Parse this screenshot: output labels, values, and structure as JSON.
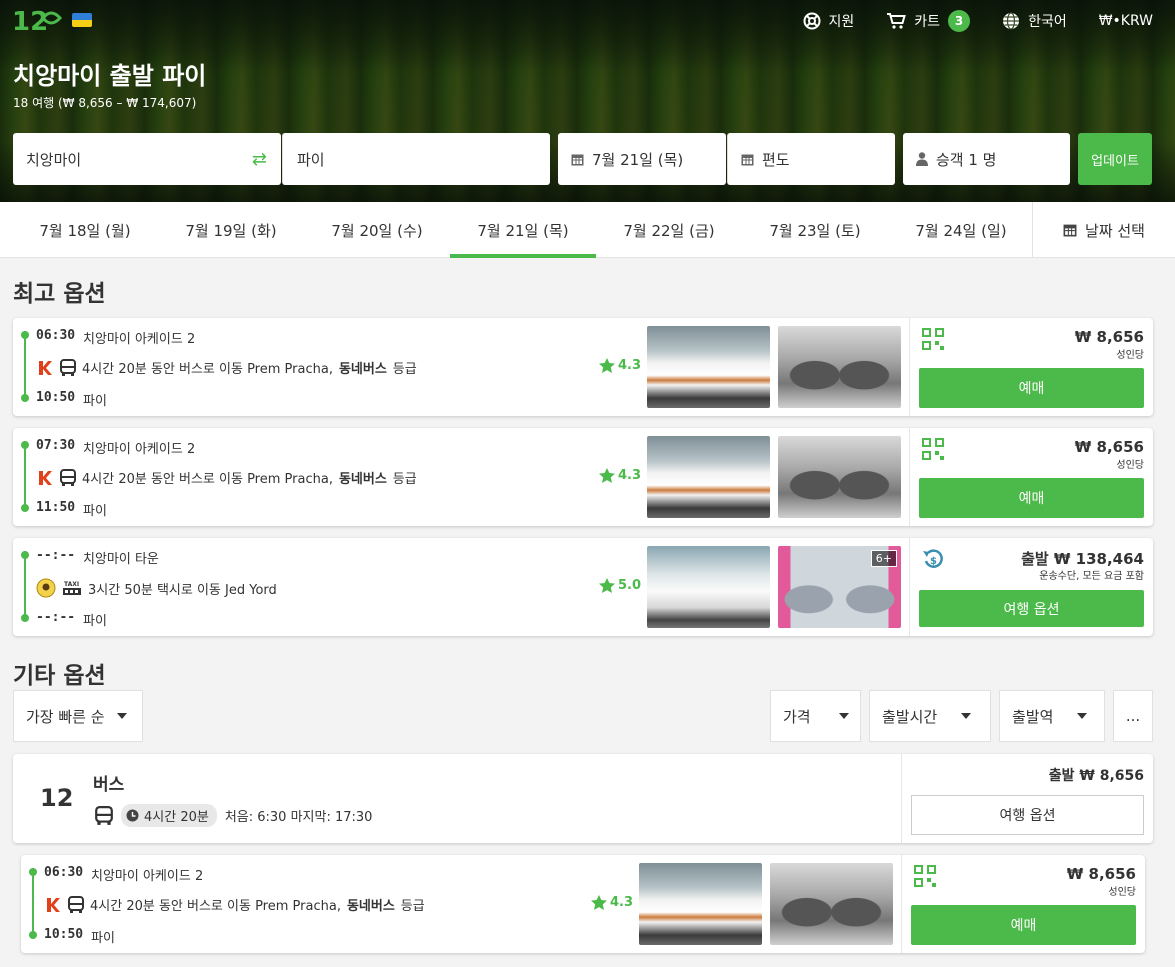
{
  "header": {
    "support": "지원",
    "cart": "카트",
    "cart_count": "3",
    "language": "한국어",
    "currency": "₩•KRW"
  },
  "hero": {
    "title": "치앙마이 출발 파이",
    "subtitle": "18 여행 (₩ 8,656 – ₩ 174,607)"
  },
  "search": {
    "from": "치앙마이",
    "to": "파이",
    "date": "7월 21일 (목)",
    "trip_type": "편도",
    "passengers": "승객 1 명",
    "update": "업데이트"
  },
  "date_tabs": [
    "7월 18일 (월)",
    "7월 19일 (화)",
    "7월 20일 (수)",
    "7월 21일 (목)",
    "7월 22일 (금)",
    "7월 23일 (토)",
    "7월 24일 (일)"
  ],
  "date_picker": "날짜 선택",
  "best": {
    "title": "최고 옵션",
    "trips": [
      {
        "dep_time": "06:30",
        "dep_place": "치앙마이 아케이드 2",
        "desc_pre": "4시간 20분 동안 버스로 이동 Prem Pracha,",
        "desc_bold": "동네버스",
        "desc_post": "등급",
        "rating": "4.3",
        "arr_time": "10:50",
        "arr_place": "파이",
        "price": "₩ 8,656",
        "price_sub": "성인당",
        "button": "예매"
      },
      {
        "dep_time": "07:30",
        "dep_place": "치앙마이 아케이드 2",
        "desc_pre": "4시간 20분 동안 버스로 이동 Prem Pracha,",
        "desc_bold": "동네버스",
        "desc_post": "등급",
        "rating": "4.3",
        "arr_time": "11:50",
        "arr_place": "파이",
        "price": "₩ 8,656",
        "price_sub": "성인당",
        "button": "예매"
      },
      {
        "dep_time": "--:--",
        "dep_place": "치앙마이 타운",
        "desc_pre": "3시간 50분 택시로 이동 Jed Yord",
        "desc_bold": "",
        "desc_post": "",
        "rating": "5.0",
        "arr_time": "--:--",
        "arr_place": "파이",
        "price": "출발 ₩ 138,464",
        "price_sub": "운송수단, 모든 요금 포함",
        "button": "여행 옵션",
        "photo_badge": "6+"
      }
    ]
  },
  "other": {
    "title": "기타 옵션",
    "sort": "가장 빠른 순",
    "filters": [
      "가격",
      "출발시간",
      "출발역"
    ],
    "more": "...",
    "operator": {
      "count": "12",
      "name": "버스",
      "duration": "4시간 20분",
      "schedule": "처음: 6:30 마지막: 17:30",
      "price": "출발 ₩ 8,656",
      "button": "여행 옵션"
    },
    "trip": {
      "dep_time": "06:30",
      "dep_place": "치앙마이 아케이드 2",
      "desc_pre": "4시간 20분 동안 버스로 이동 Prem Pracha,",
      "desc_bold": "동네버스",
      "desc_post": "등급",
      "rating": "4.3",
      "arr_time": "10:50",
      "arr_place": "파이",
      "price": "₩ 8,656",
      "price_sub": "성인당",
      "button": "예매"
    }
  },
  "colors": {
    "accent": "#4cba4a",
    "text": "#333333"
  }
}
